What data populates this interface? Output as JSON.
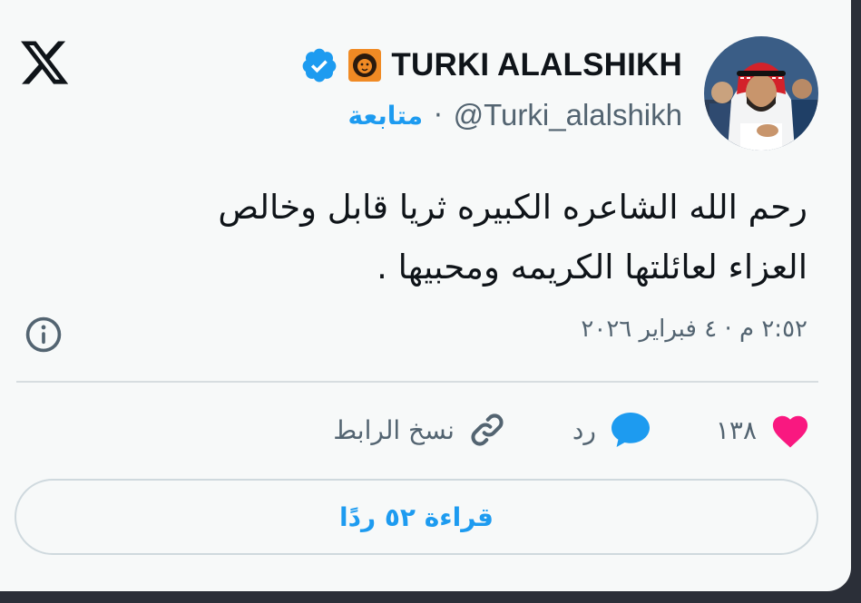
{
  "author": {
    "display_name": "TURKI ALALSHIKH",
    "handle": "@Turki_alalshikh",
    "separator": "·",
    "follow_label": "متابعة"
  },
  "tweet": {
    "text_line_1": "رحم الله الشاعره الكبيره ثريا قابل وخالص",
    "text_line_2": "العزاء لعائلتها الكريمه ومحبيها .",
    "timestamp": "٢:٥٢ م · ٤ فبراير ٢٠٢٦"
  },
  "actions": {
    "like_count": "١٣٨",
    "reply_label": "رد",
    "copy_link_label": "نسخ الرابط"
  },
  "read_replies_label": "قراءة ٥٢ ردًا",
  "colors": {
    "accent": "#1d9bf0",
    "like": "#f91880",
    "text_primary": "#0f1419",
    "text_secondary": "#536471",
    "background": "#f7f9f9"
  },
  "icons": [
    "x-logo-icon",
    "verified-badge-icon",
    "lion-flair-icon",
    "info-icon",
    "heart-icon",
    "reply-bubble-icon",
    "link-icon"
  ]
}
